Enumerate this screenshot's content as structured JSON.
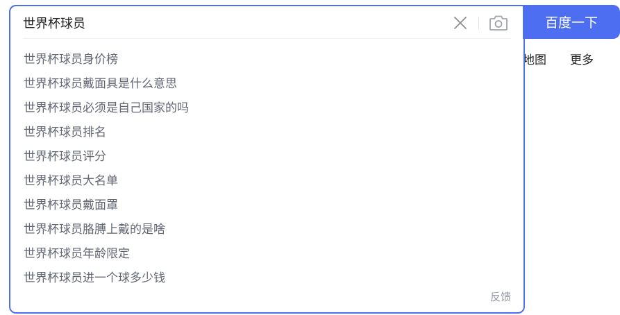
{
  "search": {
    "query": "世界杯球员",
    "button_label": "百度一下"
  },
  "nav": {
    "map": "地图",
    "more": "更多"
  },
  "icons": {
    "clear": "close-icon",
    "camera": "camera-icon"
  },
  "suggestions": [
    {
      "prefix": "世界杯球员",
      "rest": "身价榜"
    },
    {
      "prefix": "世界杯球员",
      "rest": "戴面具是什么意思"
    },
    {
      "prefix": "世界杯球员",
      "rest": "必须是自己国家的吗"
    },
    {
      "prefix": "世界杯球员",
      "rest": "排名"
    },
    {
      "prefix": "世界杯球员",
      "rest": "评分"
    },
    {
      "prefix": "世界杯球员",
      "rest": "大名单"
    },
    {
      "prefix": "世界杯球员",
      "rest": "戴面罩"
    },
    {
      "prefix": "世界杯球员",
      "rest": "胳膊上戴的是啥"
    },
    {
      "prefix": "世界杯球员",
      "rest": "年龄限定"
    },
    {
      "prefix": "世界杯球员",
      "rest": "进一个球多少钱"
    }
  ],
  "feedback_label": "反馈",
  "colors": {
    "accent": "#4e6ef2",
    "suggestion_prefix": "#626675",
    "suggestion_text": "#222222"
  }
}
